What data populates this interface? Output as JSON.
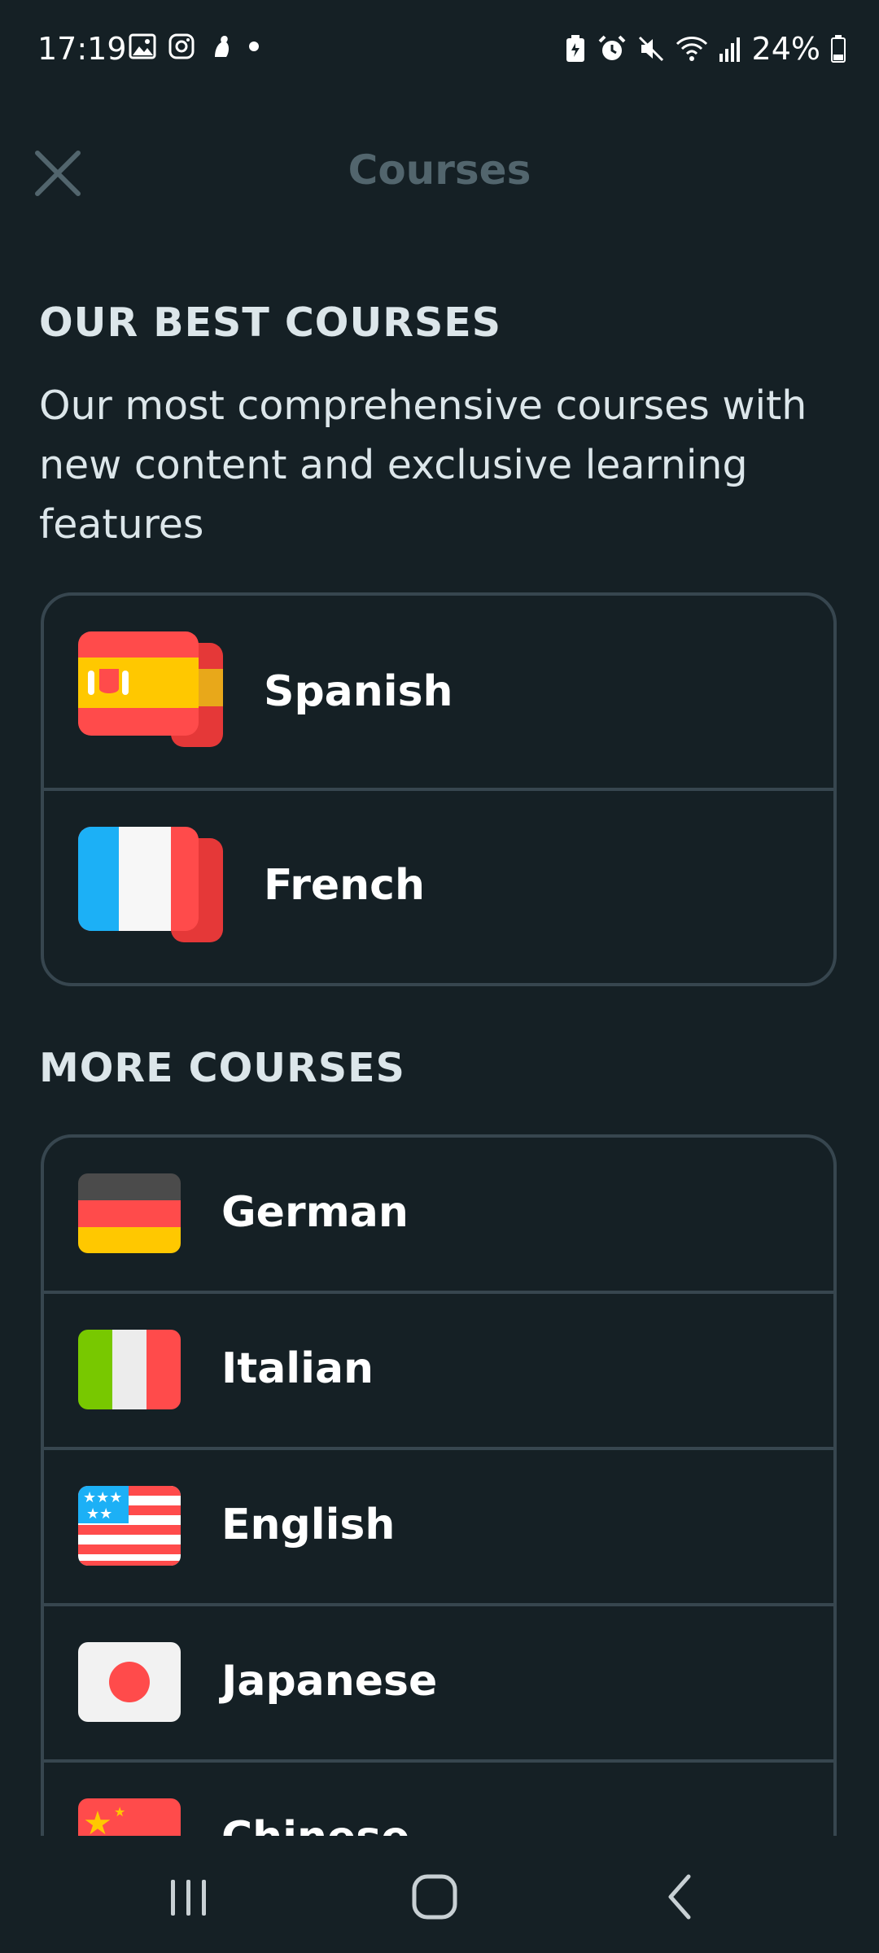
{
  "status_bar": {
    "time": "17:19",
    "battery": "24%"
  },
  "header": {
    "title": "Courses",
    "close_icon": "close-icon"
  },
  "best_courses": {
    "title": "OUR BEST COURSES",
    "description": "Our most comprehensive courses with new content and exclusive learning features",
    "items": [
      {
        "label": "Spanish",
        "flag": "spain-flag-icon"
      },
      {
        "label": "French",
        "flag": "france-flag-icon"
      }
    ]
  },
  "more_courses": {
    "title": "MORE COURSES",
    "items": [
      {
        "label": "German",
        "flag": "germany-flag-icon"
      },
      {
        "label": "Italian",
        "flag": "italy-flag-icon"
      },
      {
        "label": "English",
        "flag": "usa-flag-icon"
      },
      {
        "label": "Japanese",
        "flag": "japan-flag-icon"
      },
      {
        "label": "Chinese",
        "flag": "china-flag-icon"
      }
    ]
  },
  "colors": {
    "background": "#152025",
    "border": "#37464f",
    "title_muted": "#52656d",
    "text": "#dce6ea"
  }
}
